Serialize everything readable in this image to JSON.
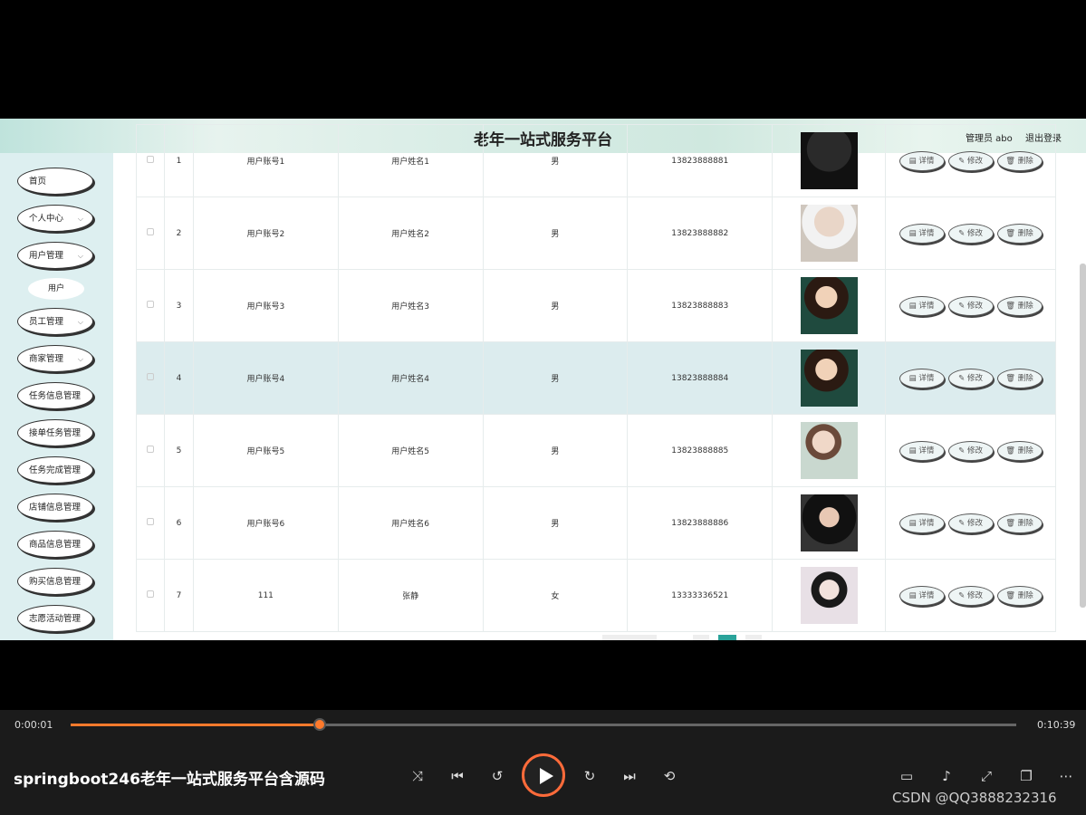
{
  "header": {
    "title": "老年一站式服务平台",
    "admin": "管理员 abo",
    "logout": "退出登录"
  },
  "sidebar": {
    "items": [
      {
        "label": "首页",
        "chev": ""
      },
      {
        "label": "个人中心",
        "chev": "⌵"
      },
      {
        "label": "用户管理",
        "chev": "⌵"
      },
      {
        "label": "员工管理",
        "chev": "⌵"
      },
      {
        "label": "商家管理",
        "chev": "⌵"
      },
      {
        "label": "任务信息管理",
        "chev": ""
      },
      {
        "label": "接单任务管理",
        "chev": ""
      },
      {
        "label": "任务完成管理",
        "chev": ""
      },
      {
        "label": "店铺信息管理",
        "chev": ""
      },
      {
        "label": "商品信息管理",
        "chev": ""
      },
      {
        "label": "购买信息管理",
        "chev": ""
      },
      {
        "label": "志愿活动管理",
        "chev": ""
      }
    ],
    "sub_item": "用户"
  },
  "table": {
    "rows": [
      {
        "idx": "1",
        "account": "用户账号1",
        "name": "用户姓名1",
        "gender": "男",
        "phone": "13823888881"
      },
      {
        "idx": "2",
        "account": "用户账号2",
        "name": "用户姓名2",
        "gender": "男",
        "phone": "13823888882"
      },
      {
        "idx": "3",
        "account": "用户账号3",
        "name": "用户姓名3",
        "gender": "男",
        "phone": "13823888883"
      },
      {
        "idx": "4",
        "account": "用户账号4",
        "name": "用户姓名4",
        "gender": "男",
        "phone": "13823888884"
      },
      {
        "idx": "5",
        "account": "用户账号5",
        "name": "用户姓名5",
        "gender": "男",
        "phone": "13823888885"
      },
      {
        "idx": "6",
        "account": "用户账号6",
        "name": "用户姓名6",
        "gender": "男",
        "phone": "13823888886"
      },
      {
        "idx": "7",
        "account": "111",
        "name": "张静",
        "gender": "女",
        "phone": "13333336521"
      }
    ],
    "actions": {
      "detail": "详情",
      "edit": "修改",
      "delete": "删除"
    }
  },
  "player": {
    "current_time": "0:00:01",
    "total_time": "0:10:39",
    "progress": 0.263,
    "video_title": "springboot246老年一站式服务平台含源码",
    "watermark": "CSDN @QQ3888232316"
  },
  "colors": {
    "accent": "#ff7a2c",
    "highlight_row": "#dcecee",
    "sidebar_bg": "#ddeff0"
  }
}
